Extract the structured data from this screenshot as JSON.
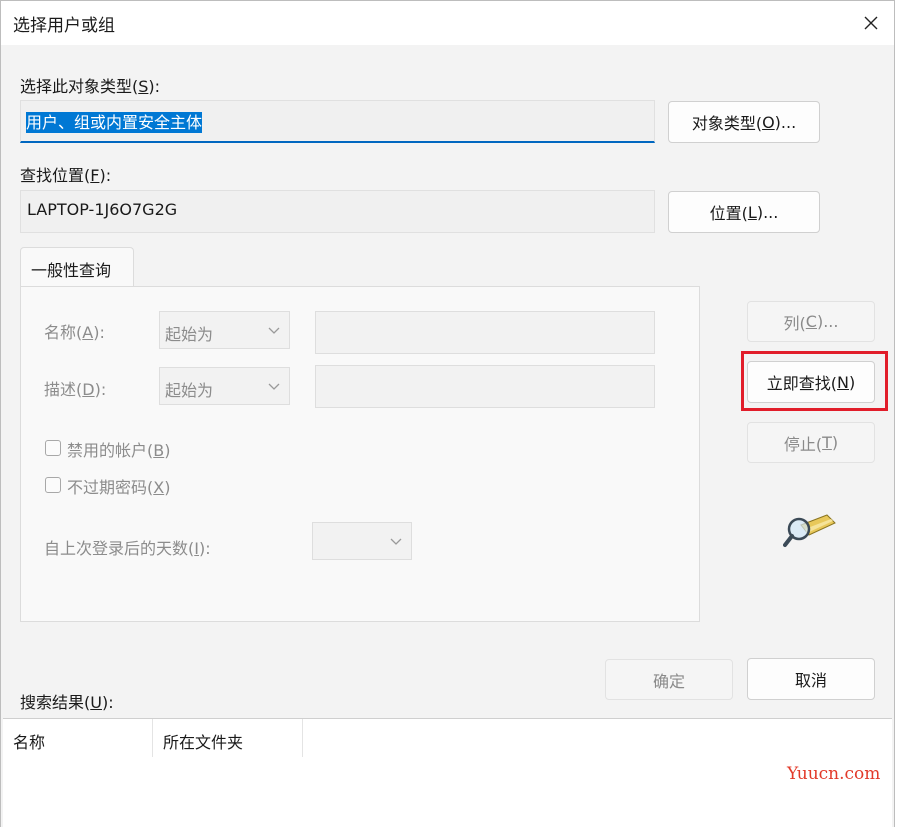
{
  "dialog": {
    "title": "选择用户或组",
    "object_type_label": "选择此对象类型(",
    "object_type_key": "S",
    "object_type_label_end": "):",
    "object_type_value": "用户、组或内置安全主体",
    "object_type_button": "对象类型(",
    "object_type_button_key": "O",
    "object_type_button_end": ")...",
    "location_label": "查找位置(",
    "location_key": "F",
    "location_label_end": "):",
    "location_value": "LAPTOP-1J6O7G2G",
    "location_button": "位置(",
    "location_button_key": "L",
    "location_button_end": ")..."
  },
  "query": {
    "tab_label": "一般性查询",
    "name_label": "名称(",
    "name_key": "A",
    "name_label_end": "):",
    "name_match": "起始为",
    "desc_label": "描述(",
    "desc_key": "D",
    "desc_label_end": "):",
    "desc_match": "起始为",
    "disabled_accounts": "禁用的帐户(",
    "disabled_accounts_key": "B",
    "disabled_accounts_end": ")",
    "non_expiring": "不过期密码(",
    "non_expiring_key": "X",
    "non_expiring_end": ")",
    "days_label": "自上次登录后的天数(",
    "days_key": "I",
    "days_label_end": "):"
  },
  "side_buttons": {
    "columns": "列(",
    "columns_key": "C",
    "columns_end": ")...",
    "find_now": "立即查找(",
    "find_now_key": "N",
    "find_now_end": ")",
    "stop": "停止(",
    "stop_key": "T",
    "stop_end": ")"
  },
  "footer": {
    "ok": "确定",
    "cancel": "取消",
    "results_label": "搜索结果(",
    "results_key": "U",
    "results_label_end": "):"
  },
  "results_columns": [
    "名称",
    "所在文件夹"
  ],
  "watermark": "Yuucn.com",
  "colors": {
    "accent": "#0078d4",
    "highlight": "#e11d2a"
  },
  "icons": [
    "close-icon",
    "chevron-down-icon",
    "search-icon"
  ]
}
